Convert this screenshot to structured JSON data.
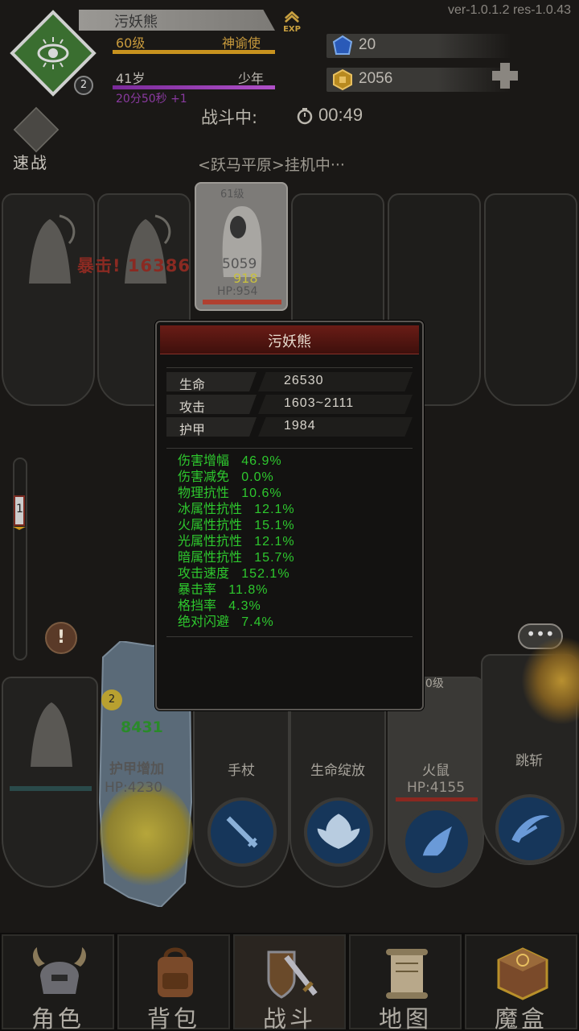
{
  "version": "ver-1.0.1.2  res-1.0.43",
  "player": {
    "level_badge": "2",
    "name": "污妖熊",
    "exp_label": "EXP",
    "level": "60级",
    "title": "神谕使",
    "age": "41岁",
    "age_stage": "少年",
    "age_timer": "20分50秒 +1"
  },
  "resources": {
    "gems": "20",
    "gold": "2056"
  },
  "battle": {
    "status_label": "战斗中:",
    "timer": "00:49",
    "speed_label": "速战",
    "zone": "<跃马平原>挂机中···"
  },
  "enemies": {
    "damage_text": "暴击! 16386",
    "target": {
      "level": "61级",
      "hp": "HP:954",
      "dmg_grey": "5059",
      "dmg_yellow": "918"
    }
  },
  "side": {
    "gauge_value": "1",
    "alert": "!",
    "chat": "•••"
  },
  "stats_popup": {
    "title": "污妖熊",
    "base": [
      {
        "label": "生命",
        "value": "26530"
      },
      {
        "label": "攻击",
        "value": "1603~2111"
      },
      {
        "label": "护甲",
        "value": "1984"
      }
    ],
    "extra": [
      {
        "label": "伤害增幅",
        "value": "46.9%"
      },
      {
        "label": "伤害减免",
        "value": "0.0%"
      },
      {
        "label": "物理抗性",
        "value": "10.6%"
      },
      {
        "label": "冰属性抗性",
        "value": "12.1%"
      },
      {
        "label": "火属性抗性",
        "value": "15.1%"
      },
      {
        "label": "光属性抗性",
        "value": "12.1%"
      },
      {
        "label": "暗属性抗性",
        "value": "15.7%"
      },
      {
        "label": "攻击速度",
        "value": "152.1%"
      },
      {
        "label": "暴击率",
        "value": "11.8%"
      },
      {
        "label": "格挡率",
        "value": "4.3%"
      },
      {
        "label": "绝对闪避",
        "value": "7.4%"
      }
    ]
  },
  "heroes": {
    "ice_badge": "2",
    "ice_damage": "8431",
    "ice_skill": "护甲增加",
    "ice_hp": "HP:4230",
    "staff_name": "手杖",
    "bloom_name": "生命绽放",
    "rat_level": "60级",
    "rat_name": "火鼠",
    "rat_hp": "HP:4155",
    "slash_name": "跳斩"
  },
  "nav": [
    {
      "label": "角色",
      "icon": "helmet-icon"
    },
    {
      "label": "背包",
      "icon": "backpack-icon"
    },
    {
      "label": "战斗",
      "icon": "sword-shield-icon"
    },
    {
      "label": "地图",
      "icon": "scroll-map-icon"
    },
    {
      "label": "魔盒",
      "icon": "magic-box-icon"
    }
  ]
}
